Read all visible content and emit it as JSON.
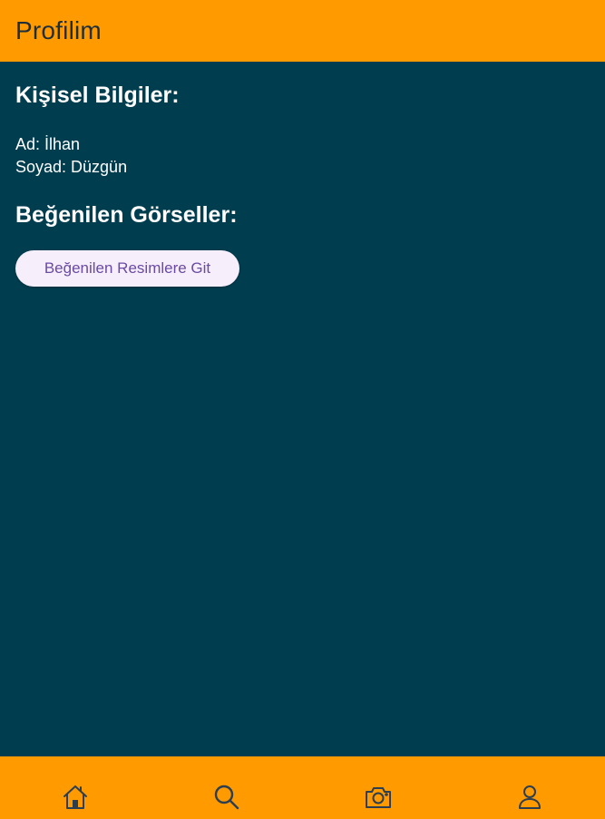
{
  "app_bar": {
    "title": "Profilim"
  },
  "personal_section": {
    "heading": "Kişisel Bilgiler:",
    "first_name_line": "Ad: İlhan",
    "last_name_line": "Soyad: Düzgün"
  },
  "liked_section": {
    "heading": "Beğenilen Görseller:",
    "button_label": "Beğenilen Resimlere Git"
  },
  "bottom_nav": {
    "items": [
      {
        "icon": "home-icon"
      },
      {
        "icon": "search-icon"
      },
      {
        "icon": "camera-icon"
      },
      {
        "icon": "person-icon"
      }
    ]
  },
  "colors": {
    "app_bar": "#ff9b00",
    "background": "#003d4f",
    "button_bg": "#f6eefa",
    "button_text": "#6a4aa3",
    "nav_icon": "#2c3e50"
  }
}
